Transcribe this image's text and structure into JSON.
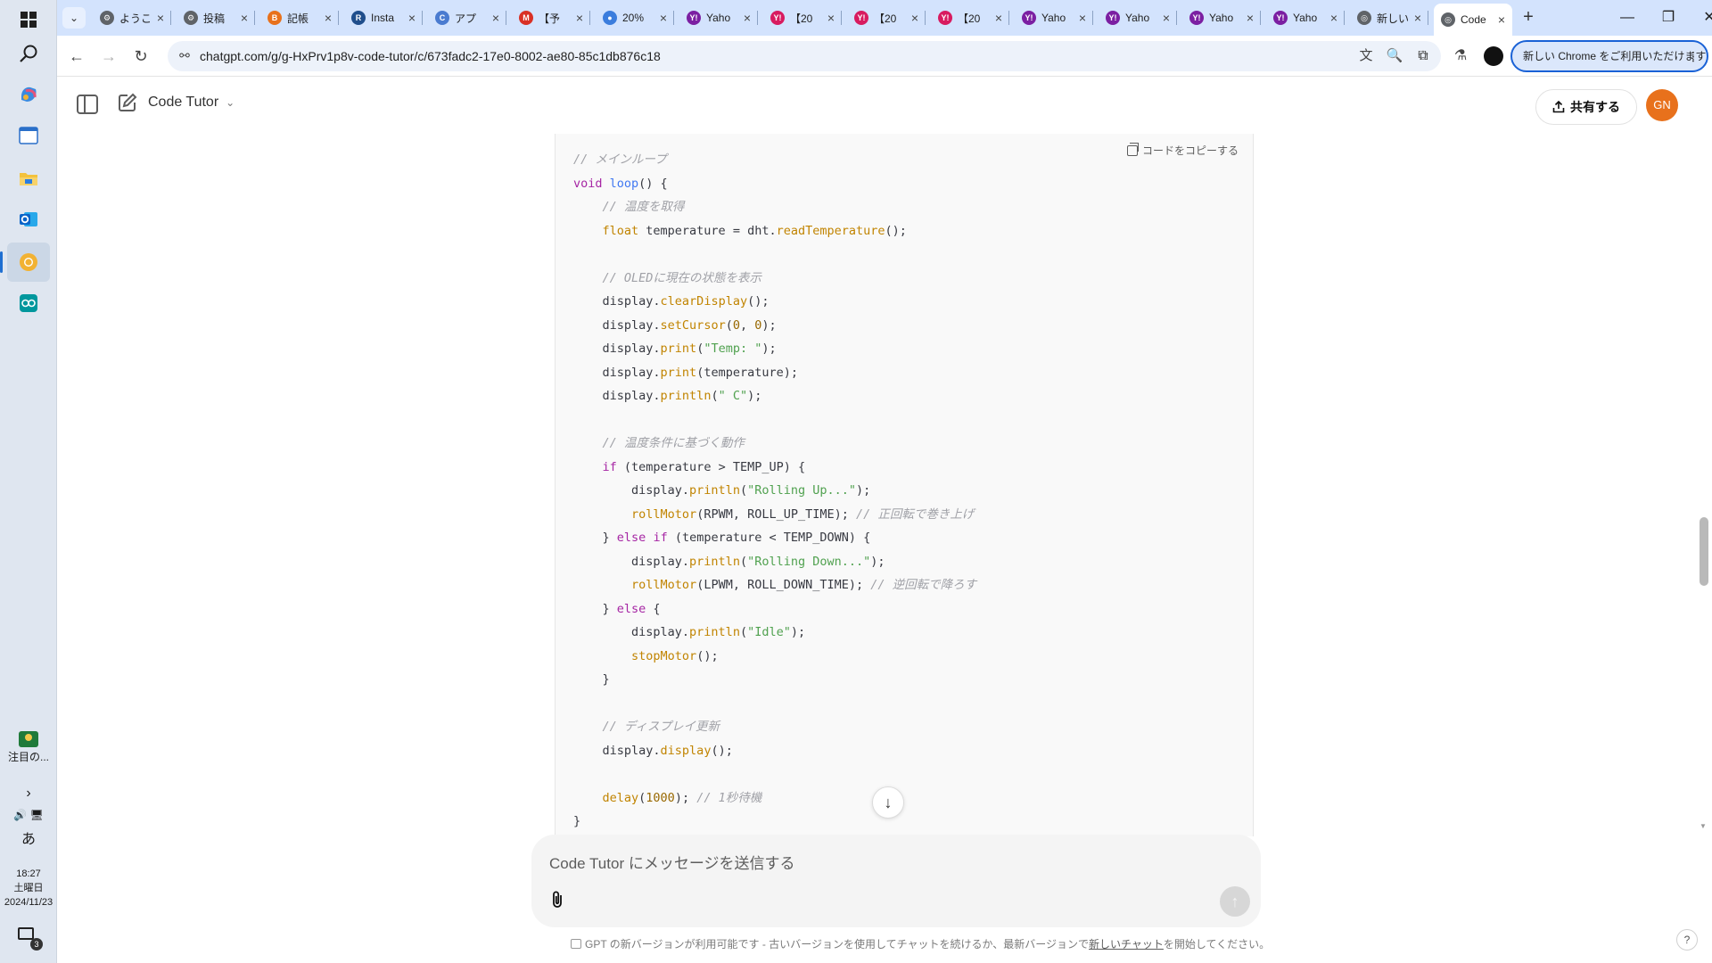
{
  "taskbar": {
    "apps": [
      {
        "name": "start",
        "icon": "windows-logo"
      },
      {
        "name": "search",
        "icon": "search-icon"
      },
      {
        "name": "copilot",
        "icon": "copilot-icon"
      },
      {
        "name": "desktop",
        "icon": "window-icon"
      },
      {
        "name": "explorer",
        "icon": "folder-icon"
      },
      {
        "name": "outlook",
        "icon": "outlook-icon"
      },
      {
        "name": "chrome",
        "icon": "chrome-icon"
      },
      {
        "name": "arduino",
        "icon": "arduino-icon"
      }
    ],
    "widget_label": "注目の...",
    "ime": "あ",
    "clock": {
      "time": "18:27",
      "day": "土曜日",
      "date": "2024/11/23"
    },
    "notification_count": "3"
  },
  "browser": {
    "tabs": [
      {
        "title": "ようこ",
        "favicon_color": "#5f6368",
        "favicon_glyph": "⚙"
      },
      {
        "title": "投稿",
        "favicon_color": "#5f6368",
        "favicon_glyph": "⚙"
      },
      {
        "title": "記帳",
        "favicon_color": "#e8711c",
        "favicon_glyph": "B"
      },
      {
        "title": "Insta",
        "favicon_color": "#1f4e8c",
        "favicon_glyph": "R"
      },
      {
        "title": "アプ",
        "favicon_color": "#4a7bd0",
        "favicon_glyph": "C"
      },
      {
        "title": "【予",
        "favicon_color": "#d93025",
        "favicon_glyph": "M"
      },
      {
        "title": "20%",
        "favicon_color": "#3b7ddd",
        "favicon_glyph": "●"
      },
      {
        "title": "Yaho",
        "favicon_color": "#7b1fa2",
        "favicon_glyph": "Y!"
      },
      {
        "title": "【20",
        "favicon_color": "#d81b60",
        "favicon_glyph": "Y!"
      },
      {
        "title": "【20",
        "favicon_color": "#d81b60",
        "favicon_glyph": "Y!"
      },
      {
        "title": "【20",
        "favicon_color": "#d81b60",
        "favicon_glyph": "Y!"
      },
      {
        "title": "Yaho",
        "favicon_color": "#7b1fa2",
        "favicon_glyph": "Y!"
      },
      {
        "title": "Yaho",
        "favicon_color": "#7b1fa2",
        "favicon_glyph": "Y!"
      },
      {
        "title": "Yaho",
        "favicon_color": "#7b1fa2",
        "favicon_glyph": "Y!"
      },
      {
        "title": "Yaho",
        "favicon_color": "#7b1fa2",
        "favicon_glyph": "Y!"
      },
      {
        "title": "新しい",
        "favicon_color": "#5f6368",
        "favicon_glyph": "◎"
      },
      {
        "title": "Code",
        "favicon_color": "#5f6368",
        "favicon_glyph": "◎",
        "active": true
      }
    ],
    "url": "chatgpt.com/g/g-HxPrv1p8v-code-tutor/c/673fadc2-17e0-8002-ae80-85c1db876c18",
    "promo_label": "新しい Chrome をご利用いただけます"
  },
  "header": {
    "gpt_name": "Code Tutor",
    "share_label": "共有する",
    "avatar_initials": "GN"
  },
  "code_block": {
    "copy_label": "コードをコピーする",
    "lines": [
      [
        {
          "t": "// メインループ",
          "c": "com"
        }
      ],
      [
        {
          "t": "void",
          "c": "kw"
        },
        {
          "t": " ",
          "c": "pl"
        },
        {
          "t": "loop",
          "c": "fnb"
        },
        {
          "t": "() {",
          "c": "pl"
        }
      ],
      [
        {
          "t": "    // 温度を取得",
          "c": "com"
        }
      ],
      [
        {
          "t": "    ",
          "c": "pl"
        },
        {
          "t": "float",
          "c": "fn"
        },
        {
          "t": " temperature = dht.",
          "c": "pl"
        },
        {
          "t": "readTemperature",
          "c": "fn"
        },
        {
          "t": "();",
          "c": "pl"
        }
      ],
      [
        {
          "t": "",
          "c": "pl"
        }
      ],
      [
        {
          "t": "    // OLEDに現在の状態を表示",
          "c": "com"
        }
      ],
      [
        {
          "t": "    display.",
          "c": "pl"
        },
        {
          "t": "clearDisplay",
          "c": "fn"
        },
        {
          "t": "();",
          "c": "pl"
        }
      ],
      [
        {
          "t": "    display.",
          "c": "pl"
        },
        {
          "t": "setCursor",
          "c": "fn"
        },
        {
          "t": "(",
          "c": "pl"
        },
        {
          "t": "0",
          "c": "num"
        },
        {
          "t": ", ",
          "c": "pl"
        },
        {
          "t": "0",
          "c": "num"
        },
        {
          "t": ");",
          "c": "pl"
        }
      ],
      [
        {
          "t": "    display.",
          "c": "pl"
        },
        {
          "t": "print",
          "c": "fn"
        },
        {
          "t": "(",
          "c": "pl"
        },
        {
          "t": "\"Temp: \"",
          "c": "str"
        },
        {
          "t": ");",
          "c": "pl"
        }
      ],
      [
        {
          "t": "    display.",
          "c": "pl"
        },
        {
          "t": "print",
          "c": "fn"
        },
        {
          "t": "(temperature);",
          "c": "pl"
        }
      ],
      [
        {
          "t": "    display.",
          "c": "pl"
        },
        {
          "t": "println",
          "c": "fn"
        },
        {
          "t": "(",
          "c": "pl"
        },
        {
          "t": "\" C\"",
          "c": "str"
        },
        {
          "t": ");",
          "c": "pl"
        }
      ],
      [
        {
          "t": "",
          "c": "pl"
        }
      ],
      [
        {
          "t": "    // 温度条件に基づく動作",
          "c": "com"
        }
      ],
      [
        {
          "t": "    ",
          "c": "pl"
        },
        {
          "t": "if",
          "c": "kw"
        },
        {
          "t": " (temperature > TEMP_UP) {",
          "c": "pl"
        }
      ],
      [
        {
          "t": "        display.",
          "c": "pl"
        },
        {
          "t": "println",
          "c": "fn"
        },
        {
          "t": "(",
          "c": "pl"
        },
        {
          "t": "\"Rolling Up...\"",
          "c": "str"
        },
        {
          "t": ");",
          "c": "pl"
        }
      ],
      [
        {
          "t": "        ",
          "c": "pl"
        },
        {
          "t": "rollMotor",
          "c": "fn"
        },
        {
          "t": "(RPWM, ROLL_UP_TIME); ",
          "c": "pl"
        },
        {
          "t": "// 正回転で巻き上げ",
          "c": "com"
        }
      ],
      [
        {
          "t": "    } ",
          "c": "pl"
        },
        {
          "t": "else",
          "c": "kw"
        },
        {
          "t": " ",
          "c": "pl"
        },
        {
          "t": "if",
          "c": "kw"
        },
        {
          "t": " (temperature < TEMP_DOWN) {",
          "c": "pl"
        }
      ],
      [
        {
          "t": "        display.",
          "c": "pl"
        },
        {
          "t": "println",
          "c": "fn"
        },
        {
          "t": "(",
          "c": "pl"
        },
        {
          "t": "\"Rolling Down...\"",
          "c": "str"
        },
        {
          "t": ");",
          "c": "pl"
        }
      ],
      [
        {
          "t": "        ",
          "c": "pl"
        },
        {
          "t": "rollMotor",
          "c": "fn"
        },
        {
          "t": "(LPWM, ROLL_DOWN_TIME); ",
          "c": "pl"
        },
        {
          "t": "// 逆回転で降ろす",
          "c": "com"
        }
      ],
      [
        {
          "t": "    } ",
          "c": "pl"
        },
        {
          "t": "else",
          "c": "kw"
        },
        {
          "t": " {",
          "c": "pl"
        }
      ],
      [
        {
          "t": "        display.",
          "c": "pl"
        },
        {
          "t": "println",
          "c": "fn"
        },
        {
          "t": "(",
          "c": "pl"
        },
        {
          "t": "\"Idle\"",
          "c": "str"
        },
        {
          "t": ");",
          "c": "pl"
        }
      ],
      [
        {
          "t": "        ",
          "c": "pl"
        },
        {
          "t": "stopMotor",
          "c": "fn"
        },
        {
          "t": "();",
          "c": "pl"
        }
      ],
      [
        {
          "t": "    }",
          "c": "pl"
        }
      ],
      [
        {
          "t": "",
          "c": "pl"
        }
      ],
      [
        {
          "t": "    // ディスプレイ更新",
          "c": "com"
        }
      ],
      [
        {
          "t": "    display.",
          "c": "pl"
        },
        {
          "t": "display",
          "c": "fn"
        },
        {
          "t": "();",
          "c": "pl"
        }
      ],
      [
        {
          "t": "",
          "c": "pl"
        }
      ],
      [
        {
          "t": "    ",
          "c": "pl"
        },
        {
          "t": "delay",
          "c": "fn"
        },
        {
          "t": "(",
          "c": "pl"
        },
        {
          "t": "1000",
          "c": "num"
        },
        {
          "t": "); ",
          "c": "pl"
        },
        {
          "t": "// 1秒待機",
          "c": "com"
        }
      ],
      [
        {
          "t": "}",
          "c": "pl"
        }
      ]
    ]
  },
  "composer": {
    "placeholder": "Code Tutor にメッセージを送信する"
  },
  "footer": {
    "note_before": "GPT の新バージョンが利用可能です - 古いバージョンを使用してチャットを続けるか、最新バージョンで",
    "note_link": "新しいチャット",
    "note_after": "を開始してください。",
    "help": "?"
  },
  "page_scroll": {
    "position_fraction": 0.62,
    "visible_fraction": 0.1
  }
}
